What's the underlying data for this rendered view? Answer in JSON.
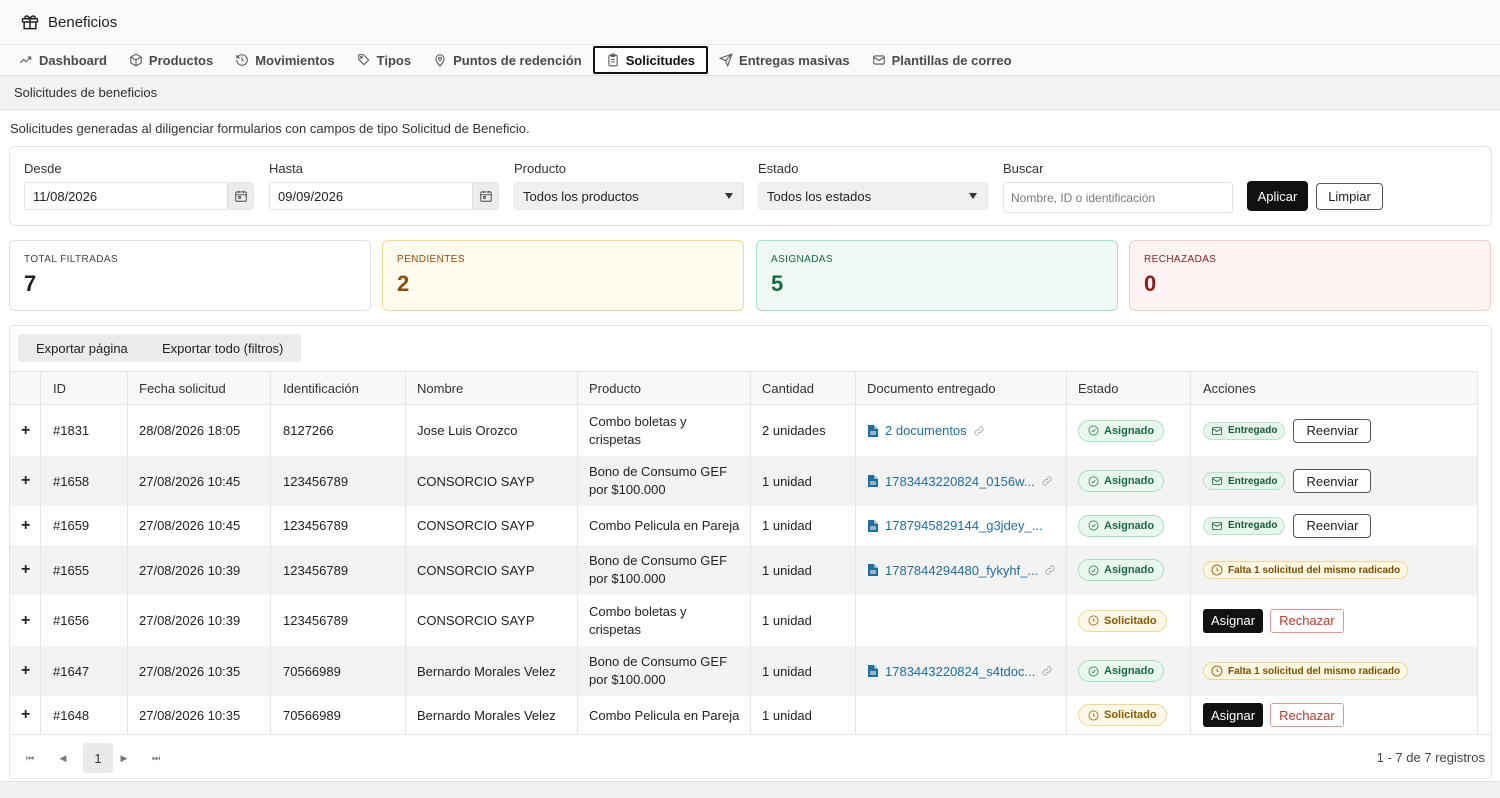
{
  "app": {
    "title": "Beneficios"
  },
  "tabs": [
    {
      "label": "Dashboard",
      "icon": "trend-icon"
    },
    {
      "label": "Productos",
      "icon": "box-icon"
    },
    {
      "label": "Movimientos",
      "icon": "history-icon"
    },
    {
      "label": "Tipos",
      "icon": "tag-icon"
    },
    {
      "label": "Puntos de redención",
      "icon": "map-pin-icon"
    },
    {
      "label": "Solicitudes",
      "icon": "clipboard-icon",
      "active": true
    },
    {
      "label": "Entregas masivas",
      "icon": "send-icon"
    },
    {
      "label": "Plantillas de correo",
      "icon": "mail-icon"
    }
  ],
  "section_title": "Solicitudes de beneficios",
  "description": "Solicitudes generadas al diligenciar formularios con campos de tipo Solicitud de Beneficio.",
  "filters": {
    "desde_label": "Desde",
    "desde_value": "11/08/2026",
    "hasta_label": "Hasta",
    "hasta_value": "09/09/2026",
    "producto_label": "Producto",
    "producto_value": "Todos los productos",
    "estado_label": "Estado",
    "estado_value": "Todos los estados",
    "buscar_label": "Buscar",
    "buscar_placeholder": "Nombre, ID o identificación",
    "apply_label": "Aplicar",
    "clear_label": "Limpiar"
  },
  "stats": {
    "total": {
      "label": "TOTAL FILTRADAS",
      "value": "7",
      "color": "#212121"
    },
    "pendientes": {
      "label": "PENDIENTES",
      "value": "2",
      "color": "#8a4b08"
    },
    "asignadas": {
      "label": "ASIGNADAS",
      "value": "5",
      "color": "#146c43"
    },
    "rechazadas": {
      "label": "RECHAZADAS",
      "value": "0",
      "color": "#8b1e1e"
    }
  },
  "export": {
    "page_label": "Exportar página",
    "all_label": "Exportar todo (filtros)"
  },
  "table": {
    "headers": {
      "id": "ID",
      "fecha": "Fecha solicitud",
      "ident": "Identificación",
      "nombre": "Nombre",
      "producto": "Producto",
      "cantidad": "Cantidad",
      "documento": "Documento entregado",
      "estado": "Estado",
      "acciones": "Acciones"
    },
    "expand_symbol": "+",
    "rows": [
      {
        "id": "#1831",
        "fecha": "28/08/2026 18:05",
        "ident": "8127266",
        "nombre": "Jose Luis Orozco",
        "producto_l1": "Combo boletas y",
        "producto_l2": "crispetas",
        "cantidad": "2 unidades",
        "documento": "2 documentos",
        "estado": "Asignado",
        "accion_pill": "Entregado",
        "accion_btn": "Reenviar"
      },
      {
        "id": "#1658",
        "fecha": "27/08/2026 10:45",
        "ident": "123456789",
        "nombre": "CONSORCIO SAYP",
        "producto_l1": "Bono de Consumo GEF",
        "producto_l2": "por $100.000",
        "cantidad": "1 unidad",
        "documento": "1783443220824_0156w...",
        "estado": "Asignado",
        "accion_pill": "Entregado",
        "accion_btn": "Reenviar"
      },
      {
        "id": "#1659",
        "fecha": "27/08/2026 10:45",
        "ident": "123456789",
        "nombre": "CONSORCIO SAYP",
        "producto_l1": "Combo Pelicula en Pareja",
        "producto_l2": "",
        "cantidad": "1 unidad",
        "documento": "1787945829144_g3jdey_...",
        "estado": "Asignado",
        "accion_pill": "Entregado",
        "accion_btn": "Reenviar"
      },
      {
        "id": "#1655",
        "fecha": "27/08/2026 10:39",
        "ident": "123456789",
        "nombre": "CONSORCIO SAYP",
        "producto_l1": "Bono de Consumo GEF",
        "producto_l2": "por $100.000",
        "cantidad": "1 unidad",
        "documento": "1787844294480_fykyhf_...",
        "estado": "Asignado",
        "accion_pill": "Falta 1 solicitud del mismo radicado",
        "accion_btn": ""
      },
      {
        "id": "#1656",
        "fecha": "27/08/2026 10:39",
        "ident": "123456789",
        "nombre": "CONSORCIO SAYP",
        "producto_l1": "Combo boletas y",
        "producto_l2": "crispetas",
        "cantidad": "1 unidad",
        "documento": "",
        "estado": "Solicitado",
        "accion_assign": "Asignar",
        "accion_reject": "Rechazar"
      },
      {
        "id": "#1647",
        "fecha": "27/08/2026 10:35",
        "ident": "70566989",
        "nombre": "Bernardo Morales Velez",
        "producto_l1": "Bono de Consumo GEF",
        "producto_l2": "por $100.000",
        "cantidad": "1 unidad",
        "documento": "1783443220824_s4tdoc...",
        "estado": "Asignado",
        "accion_pill": "Falta 1 solicitud del mismo radicado",
        "accion_btn": ""
      },
      {
        "id": "#1648",
        "fecha": "27/08/2026 10:35",
        "ident": "70566989",
        "nombre": "Bernardo Morales Velez",
        "producto_l1": "Combo Pelicula en Pareja",
        "producto_l2": "",
        "cantidad": "1 unidad",
        "documento": "",
        "estado": "Solicitado",
        "accion_assign": "Asignar",
        "accion_reject": "Rechazar"
      }
    ]
  },
  "pager": {
    "first": "⏮",
    "prev": "◀",
    "page": "1",
    "next": "▶",
    "last": "⏭",
    "info": "1 - 7 de 7 registros"
  }
}
